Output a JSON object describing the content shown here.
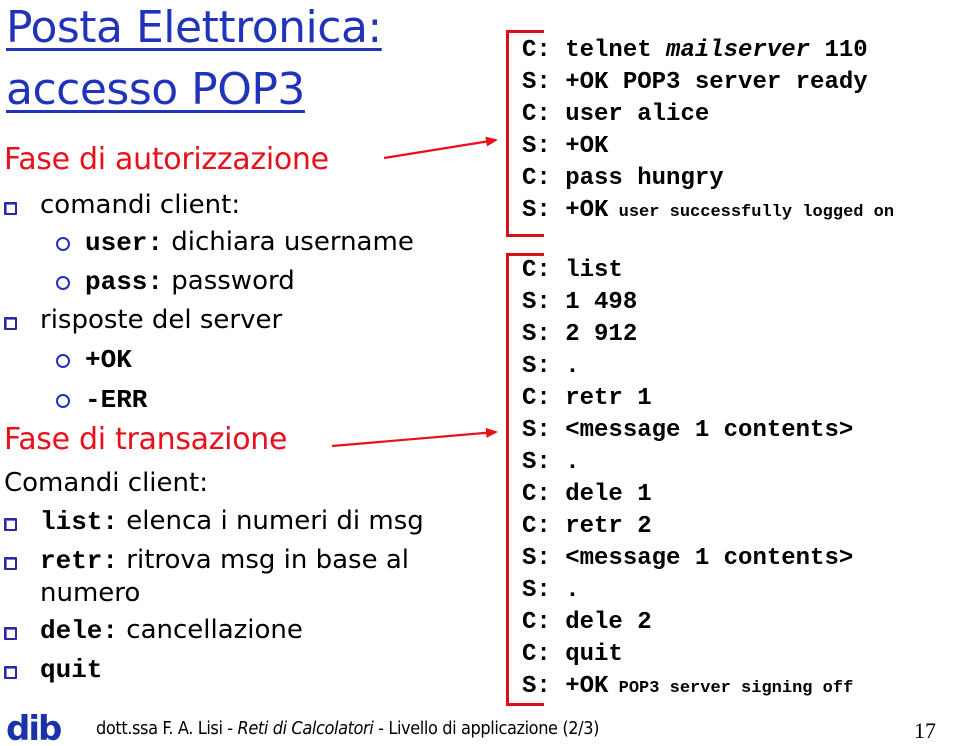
{
  "slide": {
    "title_line1": "Posta Elettronica:",
    "title_line2": "accesso POP3",
    "colors": {
      "title": "#2233bb",
      "section": "#e8101a",
      "bracket": "#d8101a",
      "bullet": "#2a2a9c"
    }
  },
  "left": {
    "auth_heading": "Fase di autorizzazione",
    "auth_items": [
      {
        "text": "comandi client:",
        "bullet": "square-bullet-icon"
      },
      {
        "code": "user:",
        "text": " dichiara username",
        "bullet": "circle-bullet-icon"
      },
      {
        "code": "pass:",
        "text": " password",
        "bullet": "circle-bullet-icon"
      },
      {
        "text": "risposte del server",
        "bullet": "square-bullet-icon"
      },
      {
        "code": "+OK",
        "text": "",
        "bullet": "circle-bullet-icon"
      },
      {
        "code": "-ERR",
        "text": "",
        "bullet": "circle-bullet-icon"
      }
    ],
    "trans_heading": "Fase di transazione",
    "trans_intro": "Comandi client:",
    "trans_items": [
      {
        "code": "list:",
        "text": " elenca i numeri di msg"
      },
      {
        "code": "retr:",
        "text": " ritrova msg in base al",
        "continuation": "numero"
      },
      {
        "code": "dele:",
        "text": " cancellazione"
      },
      {
        "code": "quit",
        "text": ""
      }
    ]
  },
  "dialog": {
    "auth_block": [
      {
        "prefix": "C: ",
        "parts": [
          {
            "t": "telnet "
          },
          {
            "t": "mailserver",
            "style": "italic"
          },
          {
            "t": " 110"
          }
        ]
      },
      {
        "prefix": "S: ",
        "parts": [
          {
            "t": "+OK POP3 server ready"
          }
        ]
      },
      {
        "prefix": "C: ",
        "parts": [
          {
            "t": "user alice"
          }
        ]
      },
      {
        "prefix": "S: ",
        "parts": [
          {
            "t": "+OK"
          }
        ]
      },
      {
        "prefix": "C: ",
        "parts": [
          {
            "t": "pass hungry"
          }
        ]
      },
      {
        "prefix": "S: ",
        "parts": [
          {
            "t": "+OK"
          },
          {
            "t": " user successfully logged on",
            "style": "small"
          }
        ]
      }
    ],
    "trans_block": [
      {
        "prefix": "C: ",
        "parts": [
          {
            "t": "list"
          }
        ]
      },
      {
        "prefix": "S: ",
        "parts": [
          {
            "t": "1 498"
          }
        ]
      },
      {
        "prefix": "S: ",
        "parts": [
          {
            "t": "2 912"
          }
        ]
      },
      {
        "prefix": "S: ",
        "parts": [
          {
            "t": "."
          }
        ]
      },
      {
        "prefix": "C: ",
        "parts": [
          {
            "t": "retr 1"
          }
        ]
      },
      {
        "prefix": "S: ",
        "parts": [
          {
            "t": "<message 1 contents>"
          }
        ]
      },
      {
        "prefix": "S: ",
        "parts": [
          {
            "t": "."
          }
        ]
      },
      {
        "prefix": "C: ",
        "parts": [
          {
            "t": "dele 1"
          }
        ]
      },
      {
        "prefix": "C: ",
        "parts": [
          {
            "t": "retr 2"
          }
        ]
      },
      {
        "prefix": "S: ",
        "parts": [
          {
            "t": "<message 1 contents>"
          }
        ]
      },
      {
        "prefix": "S: ",
        "parts": [
          {
            "t": "."
          }
        ]
      },
      {
        "prefix": "C: ",
        "parts": [
          {
            "t": "dele 2"
          }
        ]
      },
      {
        "prefix": "C: ",
        "parts": [
          {
            "t": "quit"
          }
        ]
      },
      {
        "prefix": "S: ",
        "parts": [
          {
            "t": "+OK"
          },
          {
            "t": " POP3 server signing off",
            "style": "small"
          }
        ]
      }
    ]
  },
  "footer": {
    "logo_text": "dib",
    "author": "dott.ssa F. A. Lisi - ",
    "course": "Reti di Calcolatori",
    "topic": " - Livello di applicazione (2/3)",
    "page_number": "17"
  }
}
